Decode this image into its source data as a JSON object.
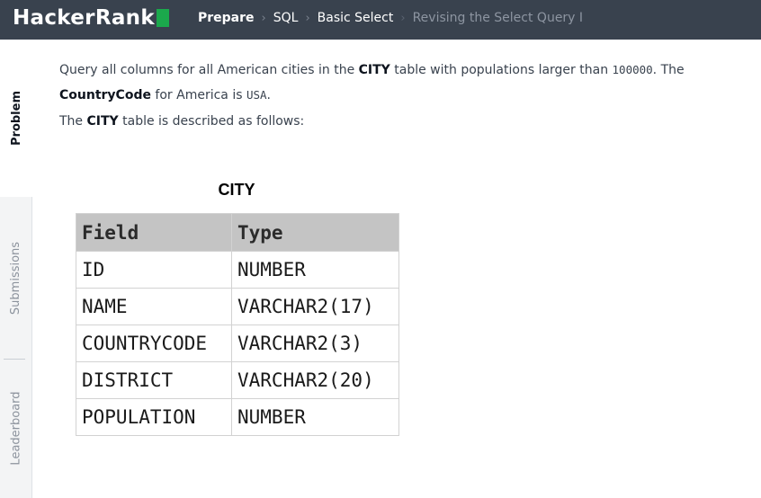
{
  "header": {
    "logo_text": "HackerRank",
    "breadcrumbs": [
      "Prepare",
      "SQL",
      "Basic Select",
      "Revising the Select Query I"
    ]
  },
  "sidebar": {
    "tabs": [
      "Problem",
      "Submissions",
      "Leaderboard"
    ],
    "active": "Problem"
  },
  "problem": {
    "p1_a": "Query all columns for all American cities in the ",
    "p1_table": "CITY",
    "p1_b": " table with populations larger than ",
    "p1_value": "100000",
    "p1_c": ". The ",
    "p1_field": "CountryCode",
    "p1_d": " for America is ",
    "p1_country": "USA",
    "p1_e": ".",
    "p2_a": "The ",
    "p2_table": "CITY",
    "p2_b": " table is described as follows:"
  },
  "table_figure": {
    "caption": "CITY",
    "headers": [
      "Field",
      "Type"
    ],
    "rows": [
      [
        "ID",
        "NUMBER"
      ],
      [
        "NAME",
        "VARCHAR2(17)"
      ],
      [
        "COUNTRYCODE",
        "VARCHAR2(3)"
      ],
      [
        "DISTRICT",
        "VARCHAR2(20)"
      ],
      [
        "POPULATION",
        "NUMBER"
      ]
    ]
  },
  "colors": {
    "header_bg": "#39424e",
    "logo_accent": "#1ba94c",
    "table_header_bg": "#c4c4c4"
  }
}
